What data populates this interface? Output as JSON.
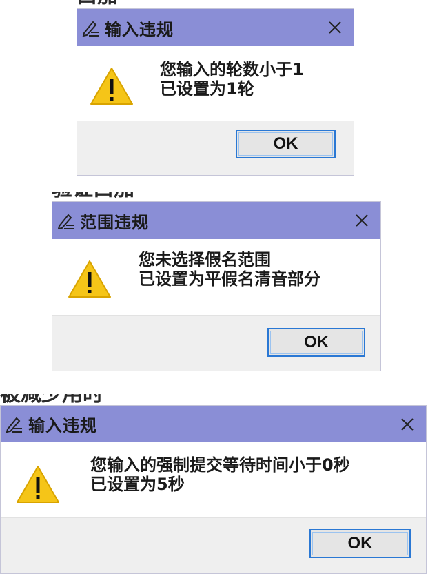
{
  "colors": {
    "titlebar": "#8a8ed6",
    "footer": "#efefef",
    "ok_border": "#2a78d4",
    "warning_fill": "#f5c518"
  },
  "background_text": {
    "fragment_1": "口加",
    "fragment_2": "验证口加",
    "fragment_3": "被减少用时"
  },
  "dialogs": [
    {
      "title_icon": "edit-pen-icon",
      "title": "输入违规",
      "close_label": "✕",
      "warning_icon": "warning-icon",
      "message_line1": "您输入的轮数小于1",
      "message_line2": "已设置为1轮",
      "ok_label": "OK"
    },
    {
      "title_icon": "edit-pen-icon",
      "title": "范围违规",
      "close_label": "✕",
      "warning_icon": "warning-icon",
      "message_line1": "您未选择假名范围",
      "message_line2": "已设置为平假名清音部分",
      "ok_label": "OK"
    },
    {
      "title_icon": "edit-pen-icon",
      "title": "输入违规",
      "close_label": "✕",
      "warning_icon": "warning-icon",
      "message_line1": "您输入的强制提交等待时间小于0秒",
      "message_line2": "已设置为5秒",
      "ok_label": "OK"
    }
  ]
}
